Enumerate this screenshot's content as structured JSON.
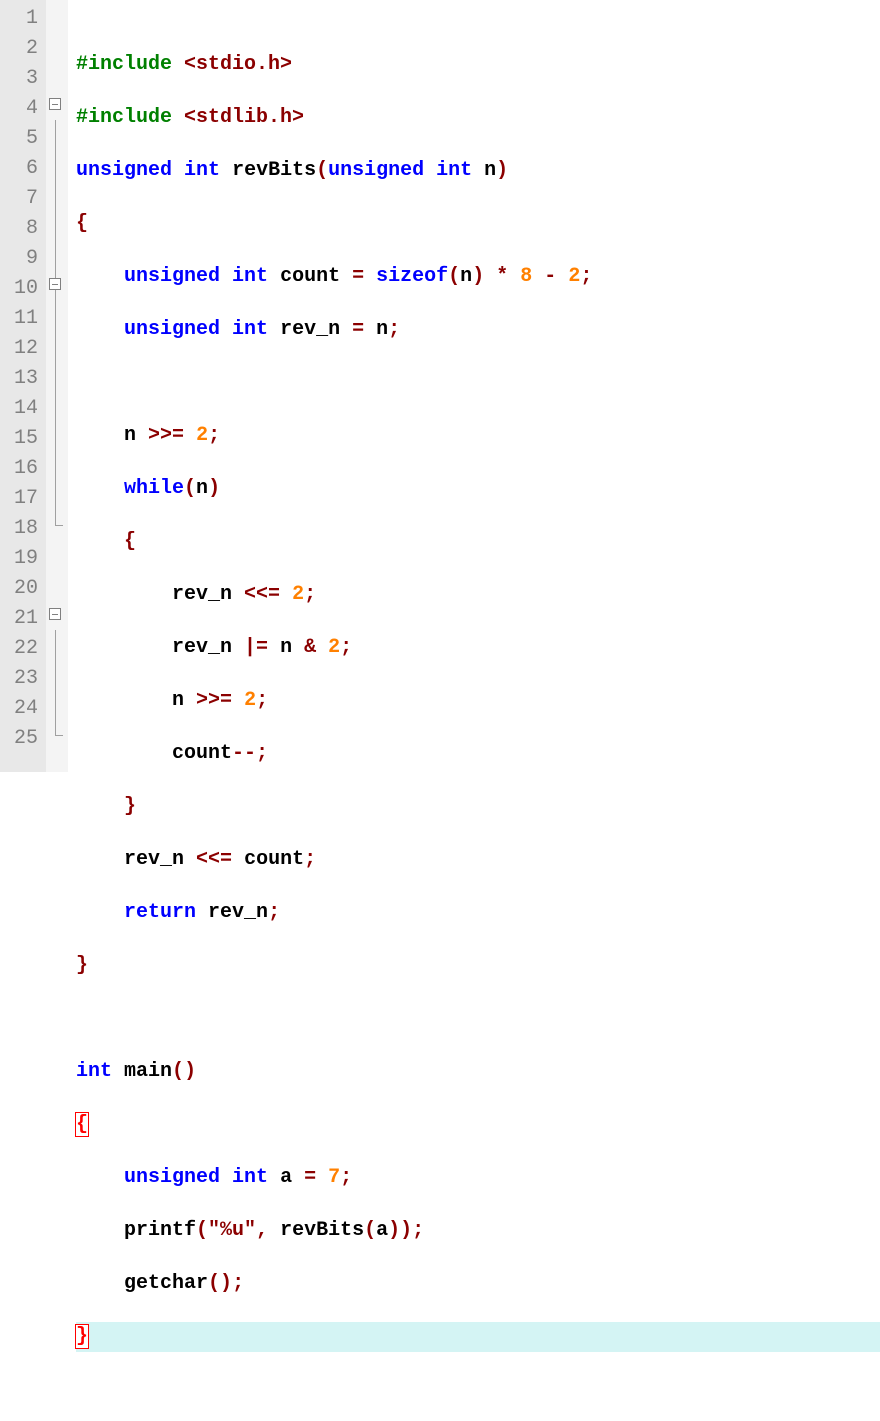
{
  "lines": {
    "l1": {
      "num": "1"
    },
    "l2": {
      "num": "2"
    },
    "l3": {
      "num": "3"
    },
    "l4": {
      "num": "4"
    },
    "l5": {
      "num": "5"
    },
    "l6": {
      "num": "6"
    },
    "l7": {
      "num": "7"
    },
    "l8": {
      "num": "8"
    },
    "l9": {
      "num": "9"
    },
    "l10": {
      "num": "10"
    },
    "l11": {
      "num": "11"
    },
    "l12": {
      "num": "12"
    },
    "l13": {
      "num": "13"
    },
    "l14": {
      "num": "14"
    },
    "l15": {
      "num": "15"
    },
    "l16": {
      "num": "16"
    },
    "l17": {
      "num": "17"
    },
    "l18": {
      "num": "18"
    },
    "l19": {
      "num": "19"
    },
    "l20": {
      "num": "20"
    },
    "l21": {
      "num": "21"
    },
    "l22": {
      "num": "22"
    },
    "l23": {
      "num": "23"
    },
    "l24": {
      "num": "24"
    },
    "l25": {
      "num": "25"
    }
  },
  "tok": {
    "include": "#include",
    "stdio": "<stdio.h>",
    "stdlib": "<stdlib.h>",
    "unsigned": "unsigned",
    "int": "int",
    "revBits": "revBits",
    "n": "n",
    "count": "count",
    "sizeof": "sizeof",
    "rev_n": "rev_n",
    "while": "while",
    "return": "return",
    "main": "main",
    "a": "a",
    "printf": "printf",
    "fmt": "\"%u\"",
    "getchar": "getchar",
    "num8": "8",
    "num2": "2",
    "num7": "7",
    "star": "*",
    "minus": "-",
    "eq": "=",
    "shr": ">>=",
    "shl": "<<=",
    "oreq": "|=",
    "amp": "&",
    "decr": "--",
    "semi": ";",
    "comma": ",",
    "lparen": "(",
    "rparen": ")",
    "lbrace": "{",
    "rbrace": "}"
  }
}
